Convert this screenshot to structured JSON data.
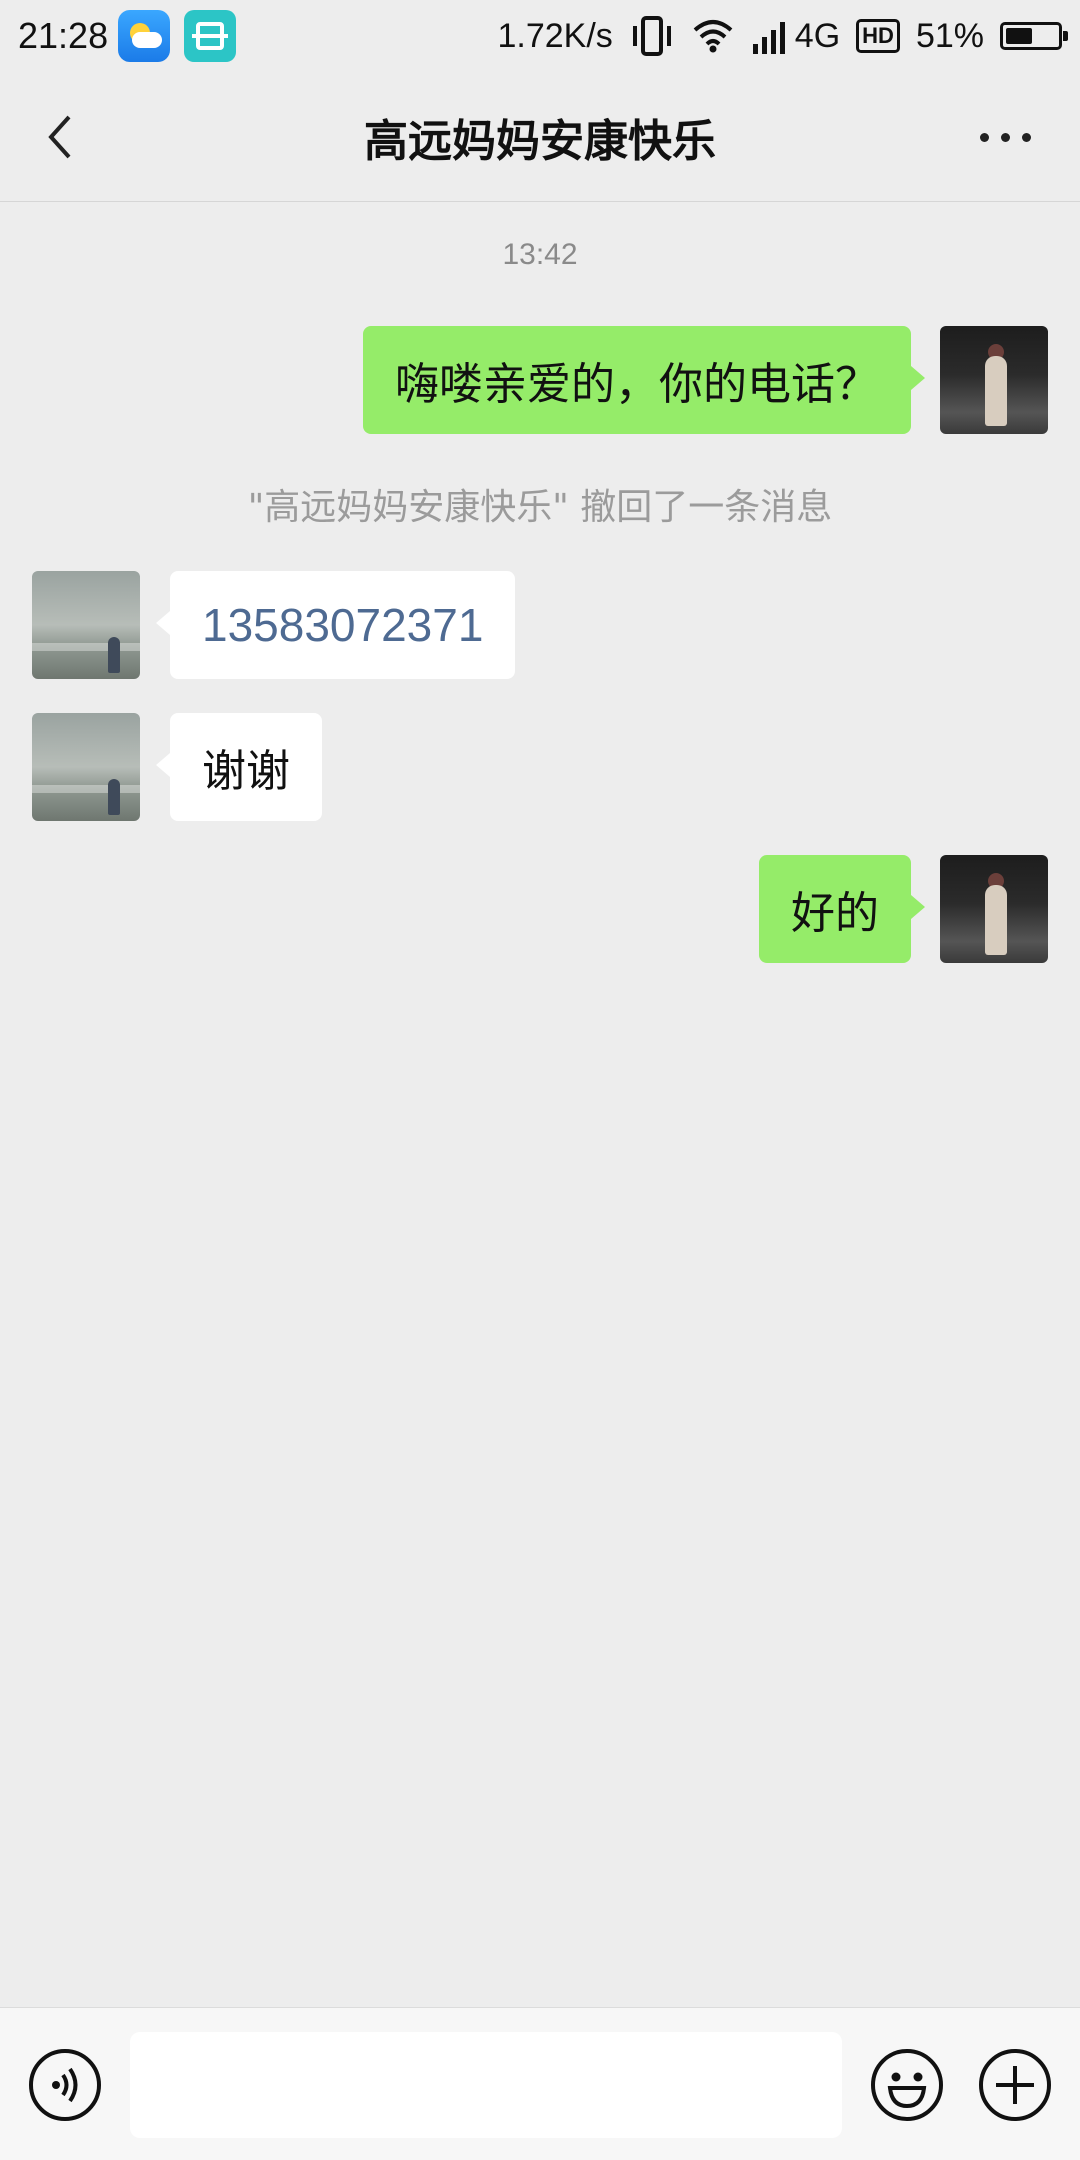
{
  "status_bar": {
    "time": "21:28",
    "network_speed": "1.72K/s",
    "network_type": "4G",
    "hd_label": "HD",
    "battery_percent": "51%",
    "battery_level": 0.51,
    "icons": [
      "weather-app-icon",
      "scan-app-icon",
      "vibrate-icon",
      "wifi-icon",
      "signal-icon",
      "hd-icon",
      "battery-icon"
    ]
  },
  "header": {
    "title": "高远妈妈安康快乐",
    "icons": [
      "back-arrow-icon",
      "more-dots-icon"
    ]
  },
  "messages": {
    "timestamp": "13:42",
    "system_note": "\"高远妈妈安康快乐\" 撤回了一条消息",
    "items": [
      {
        "direction": "outgoing",
        "text": "嗨喽亲爱的，你的电话？"
      },
      {
        "direction": "incoming",
        "text": "13583072371",
        "is_link": true
      },
      {
        "direction": "incoming",
        "text": "谢谢"
      },
      {
        "direction": "outgoing",
        "text": "好的"
      }
    ]
  },
  "input_bar": {
    "value": "",
    "icons": [
      "voice-icon",
      "emoji-icon",
      "plus-icon"
    ]
  },
  "colors": {
    "background": "#ededed",
    "outgoing_bubble": "#95ec69",
    "incoming_bubble": "#ffffff",
    "link": "#4e6a92"
  }
}
